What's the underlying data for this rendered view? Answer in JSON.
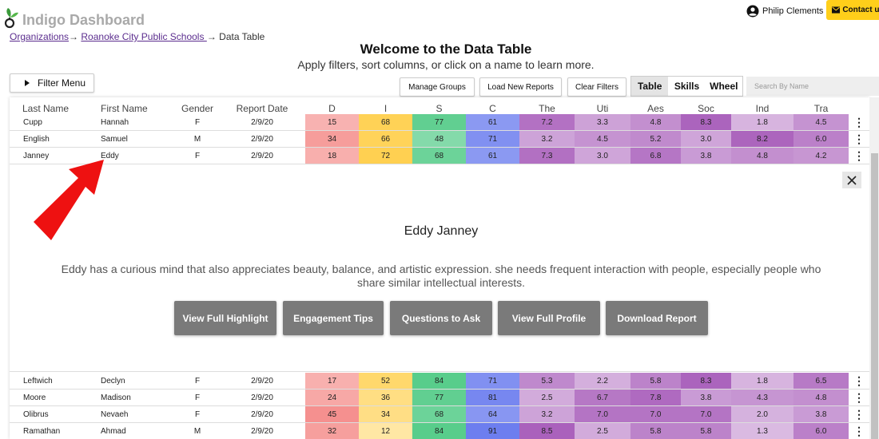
{
  "app": {
    "title": "Indigo Dashboard"
  },
  "breadcrumb": {
    "org": "Organizations",
    "school": "Roanoke City Public Schools ",
    "current": "Data Table",
    "separator": "→"
  },
  "user": {
    "name": "Philip Clements",
    "icon": "account-circle-icon"
  },
  "contact": {
    "label": "Contact us",
    "icon": "mail-icon",
    "color": "#ffcf1a"
  },
  "page": {
    "title": "Welcome to the Data Table",
    "subtitle": "Apply filters, sort columns, or click on a name to learn more."
  },
  "toolbar": {
    "filter_menu": "Filter Menu",
    "manage_groups": "Manage Groups",
    "load_new_reports": "Load New Reports",
    "clear_filters": "Clear Filters",
    "views": [
      "Table",
      "Skills",
      "Wheel"
    ],
    "active_view": "Table",
    "search_placeholder": "Search By Name"
  },
  "table": {
    "columns": [
      "Last Name",
      "First Name",
      "Gender",
      "Report Date",
      "D",
      "I",
      "S",
      "C",
      "The",
      "Uti",
      "Aes",
      "Soc",
      "Ind",
      "Tra"
    ],
    "rows_top": [
      {
        "last": "Cupp",
        "first": "Hannah",
        "gender": "F",
        "date": "2/9/20",
        "scores": [
          "15",
          "68",
          "77",
          "61",
          "7.2",
          "3.3",
          "4.8",
          "8.3",
          "1.8",
          "4.5"
        ]
      },
      {
        "last": "English",
        "first": "Samuel",
        "gender": "M",
        "date": "2/9/20",
        "scores": [
          "34",
          "66",
          "48",
          "71",
          "3.2",
          "4.5",
          "5.2",
          "3.0",
          "8.2",
          "6.0"
        ]
      },
      {
        "last": "Janney",
        "first": "Eddy",
        "gender": "F",
        "date": "2/9/20",
        "scores": [
          "18",
          "72",
          "68",
          "61",
          "7.3",
          "3.0",
          "6.8",
          "3.8",
          "4.8",
          "4.2"
        ]
      }
    ],
    "rows_bottom": [
      {
        "last": "Leftwich",
        "first": "Declyn",
        "gender": "F",
        "date": "2/9/20",
        "scores": [
          "17",
          "52",
          "84",
          "71",
          "5.3",
          "2.2",
          "5.8",
          "8.3",
          "1.8",
          "6.5"
        ]
      },
      {
        "last": "Moore",
        "first": "Madison",
        "gender": "F",
        "date": "2/9/20",
        "scores": [
          "24",
          "36",
          "77",
          "81",
          "2.5",
          "6.7",
          "7.8",
          "3.8",
          "4.3",
          "4.8"
        ]
      },
      {
        "last": "Olibrus",
        "first": "Nevaeh",
        "gender": "F",
        "date": "2/9/20",
        "scores": [
          "45",
          "34",
          "68",
          "64",
          "3.2",
          "7.0",
          "7.0",
          "7.0",
          "2.0",
          "3.8"
        ]
      },
      {
        "last": "Ramathan",
        "first": "Ahmad",
        "gender": "M",
        "date": "2/9/20",
        "scores": [
          "32",
          "12",
          "84",
          "91",
          "8.5",
          "2.5",
          "5.8",
          "5.8",
          "1.3",
          "6.0"
        ]
      }
    ],
    "row_menu_icon": "more-vert-icon"
  },
  "detail": {
    "name": "Eddy Janney",
    "description": "Eddy has a curious mind that also appreciates beauty, balance, and artistic expression. she needs frequent interaction with people, especially people who share similar intellectual interests.",
    "buttons": [
      "View Full Highlight",
      "Engagement Tips",
      "Questions to Ask",
      "View Full Profile",
      "Download Report"
    ],
    "close_icon": "close-icon"
  },
  "annotation": {
    "icon": "red-arrow-icon",
    "color": "#ee1111"
  },
  "colors": {
    "D": "#ef5350",
    "I": "#ffc62a",
    "S": "#45c77e",
    "C": "#6476ee",
    "motivator": "#a04fb4"
  }
}
